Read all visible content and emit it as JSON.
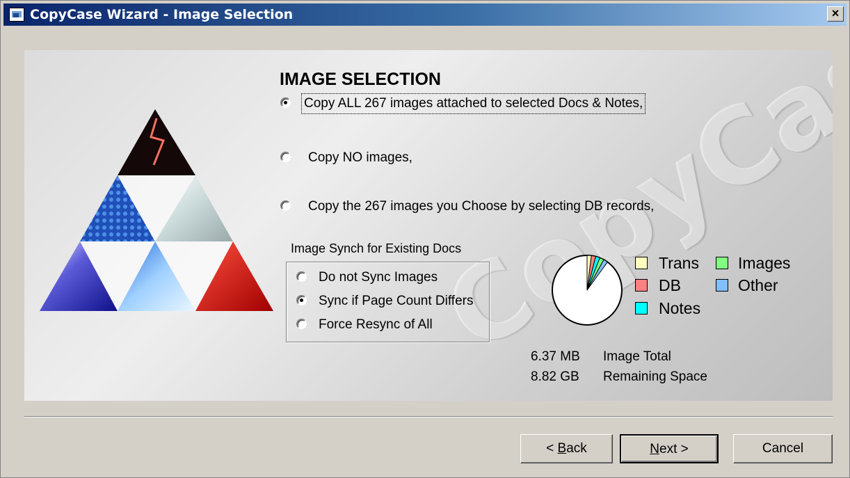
{
  "window": {
    "title": "CopyCase Wizard - Image Selection",
    "close": "×"
  },
  "panel": {
    "watermark": "CopyCase"
  },
  "selection": {
    "heading": "IMAGE SELECTION",
    "options": [
      {
        "label": "Copy ALL 267 images attached to selected Docs & Notes,",
        "checked": true
      },
      {
        "label": "Copy NO images,",
        "checked": false
      },
      {
        "label": "Copy the 267 images you Choose by selecting DB records,",
        "checked": false
      }
    ]
  },
  "sync": {
    "group_label": "Image Synch for Existing Docs",
    "options": [
      {
        "label": "Do not Sync Images",
        "checked": false
      },
      {
        "label": "Sync if Page Count Differs",
        "checked": true
      },
      {
        "label": "Force Resync of All",
        "checked": false
      }
    ]
  },
  "chart_data": {
    "type": "pie",
    "legend": [
      "Trans",
      "Images",
      "DB",
      "Other",
      "Notes"
    ],
    "colors": {
      "Trans": "#ffffc0",
      "Images": "#80ff80",
      "DB": "#ff8080",
      "Other": "#80c0ff",
      "Notes": "#00ffff"
    },
    "slices": [
      {
        "name": "Trans",
        "value": 2
      },
      {
        "name": "DB",
        "value": 2
      },
      {
        "name": "Notes",
        "value": 2
      },
      {
        "name": "Images",
        "value": 2
      },
      {
        "name": "Other",
        "value": 2
      }
    ],
    "legend_placement": "right"
  },
  "stats": {
    "image_total_value": "6.37 MB",
    "image_total_label": "Image Total",
    "remaining_value": "8.82 GB",
    "remaining_label": "Remaining Space"
  },
  "buttons": {
    "back": "Back",
    "next": "Next",
    "cancel": "Cancel"
  }
}
